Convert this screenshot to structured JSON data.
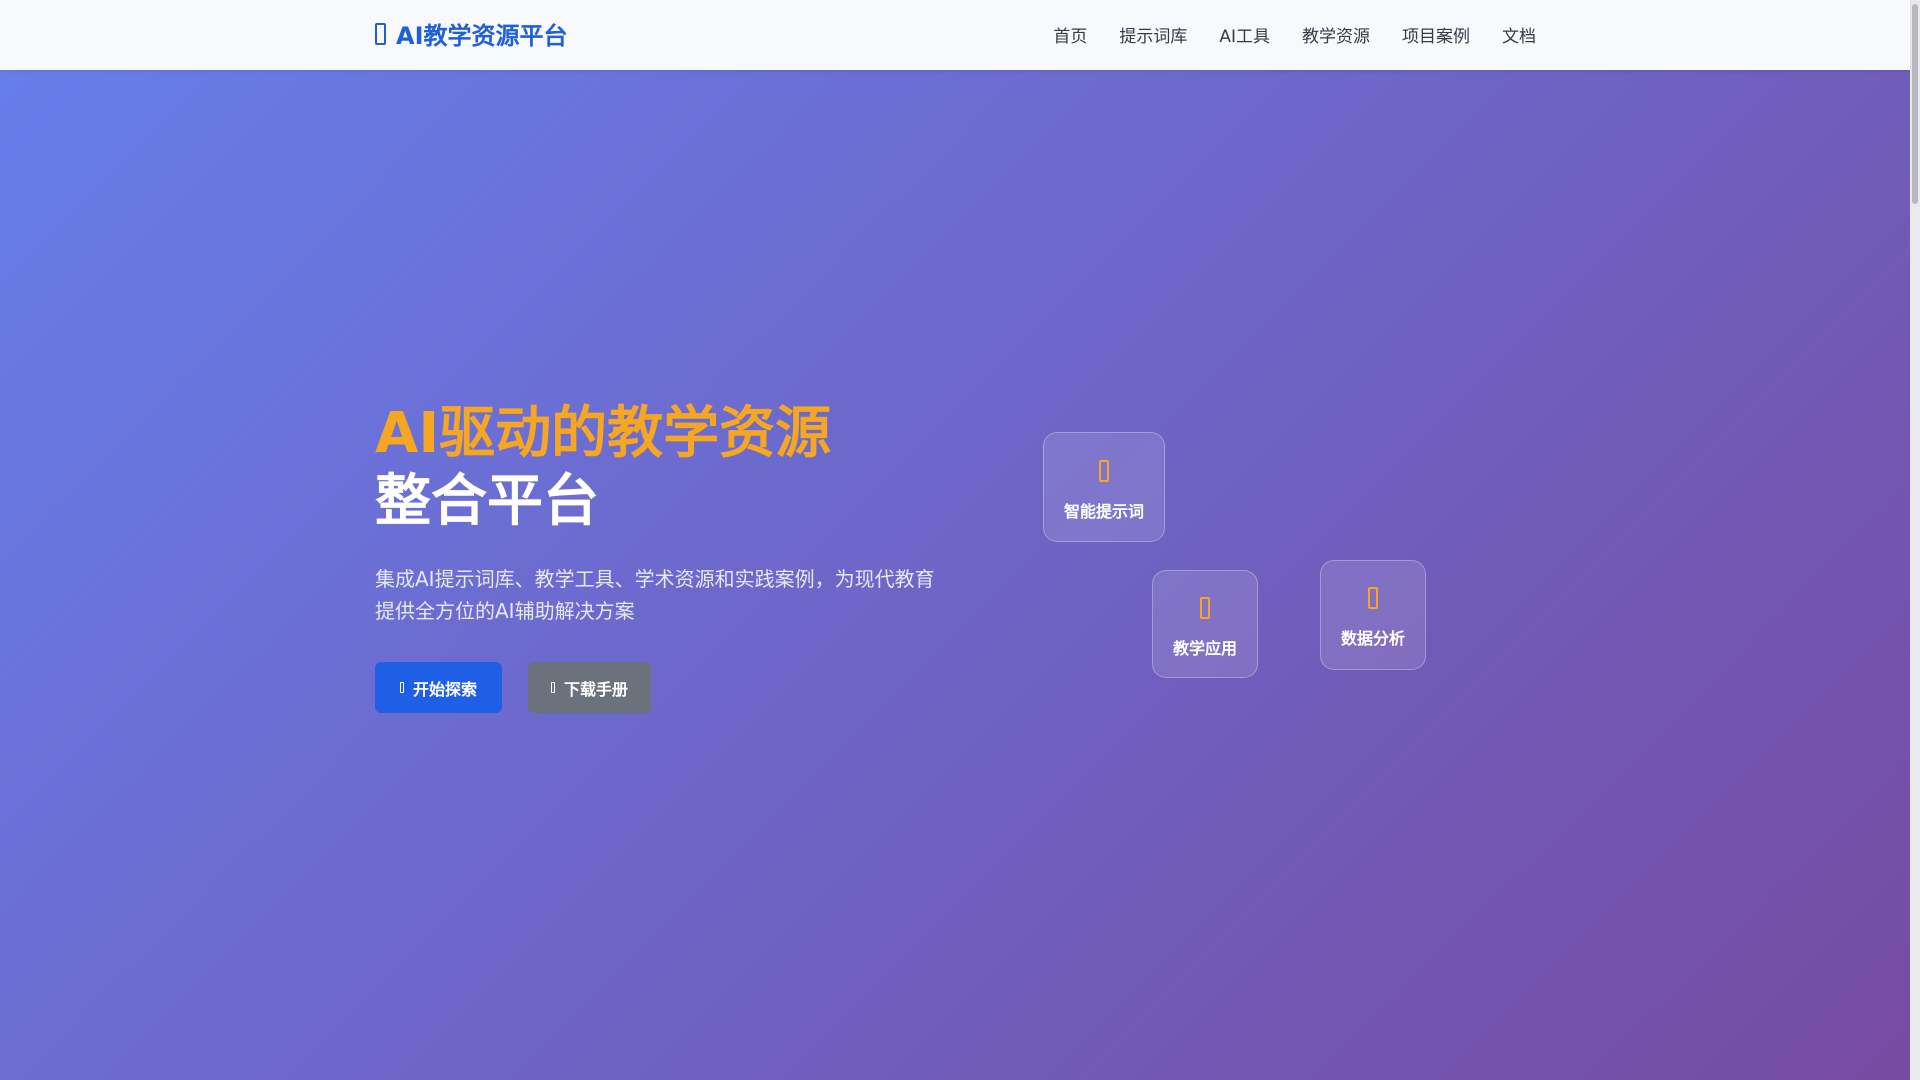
{
  "navbar": {
    "brand_icon": "graduation-icon",
    "brand": "AI教学资源平台",
    "links": [
      "首页",
      "提示词库",
      "AI工具",
      "教学资源",
      "项目案例",
      "文档"
    ]
  },
  "hero": {
    "title_accent": "AI驱动的教学资源",
    "title_main": "整合平台",
    "description": "集成AI提示词库、教学工具、学术资源和实践案例，为现代教育提供全方位的AI辅助解决方案",
    "buttons": {
      "primary": {
        "label": "开始探索",
        "icon": "rocket-icon"
      },
      "secondary": {
        "label": "下载手册",
        "icon": "download-icon"
      }
    },
    "feature_cards": [
      {
        "label": "智能提示词",
        "icon": "lightbulb-icon"
      },
      {
        "label": "教学应用",
        "icon": "chalkboard-icon"
      },
      {
        "label": "数据分析",
        "icon": "chart-icon"
      }
    ]
  },
  "colors": {
    "brand": "#1f5fd8",
    "accent": "#f5a623",
    "gradient_start": "#667eea",
    "gradient_end": "#764ba2",
    "primary_button": "#1f5fe6",
    "secondary_button": "#6c727b"
  }
}
